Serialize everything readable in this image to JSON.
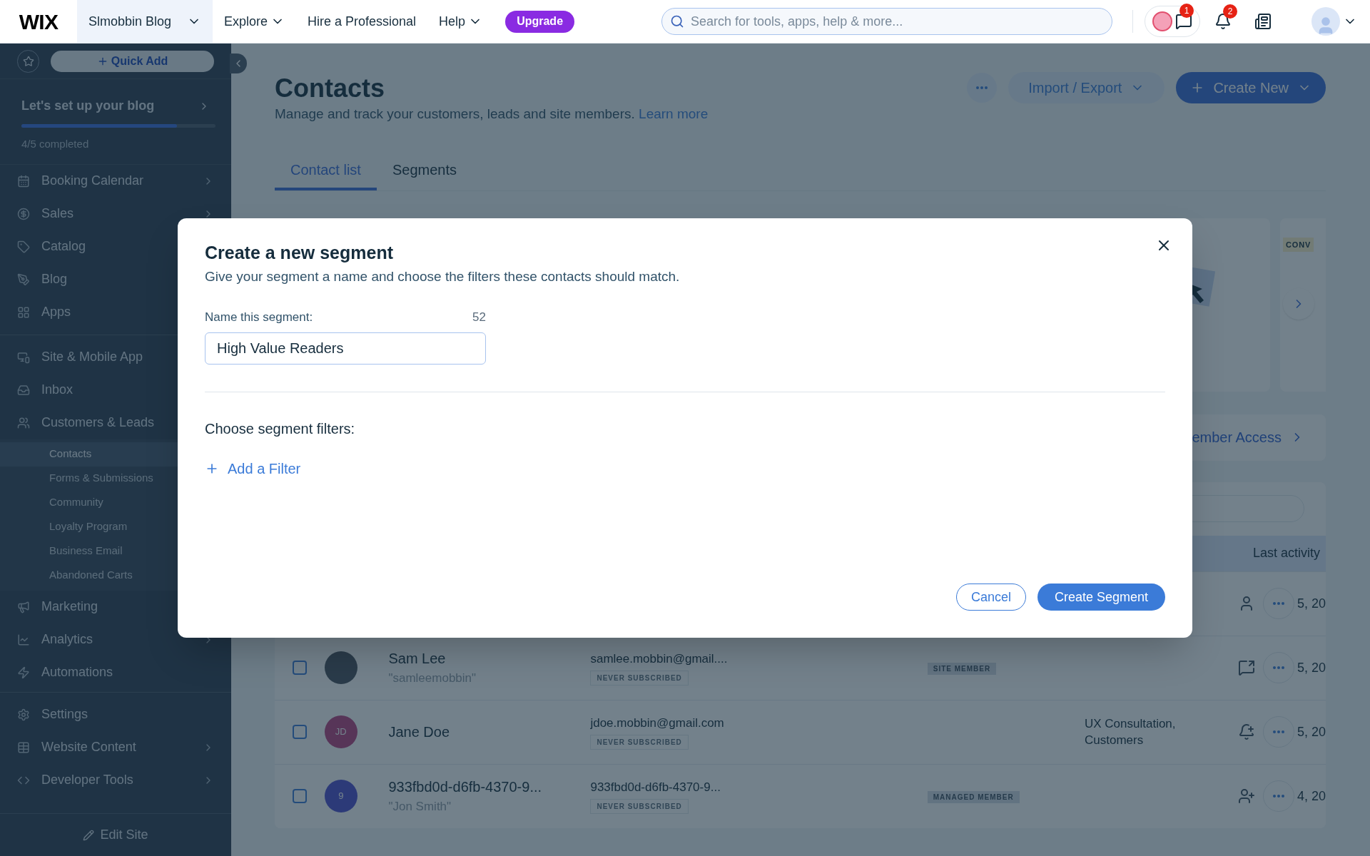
{
  "top_bar": {
    "logo": "WIX",
    "site_selector": "Slmobbin Blog",
    "nav": [
      {
        "label": "Explore",
        "dropdown": true
      },
      {
        "label": "Hire a Professional",
        "dropdown": false
      },
      {
        "label": "Help",
        "dropdown": true
      }
    ],
    "upgrade": "Upgrade",
    "search": {
      "placeholder": "Search for tools, apps, help & more..."
    },
    "chat_badge": "1",
    "notifications_badge": "2"
  },
  "sidebar": {
    "quick_add": "Quick Add",
    "setup": {
      "title": "Let's set up your blog",
      "level": 0.8,
      "progress": "4/5 completed"
    },
    "sections": [
      {
        "items": [
          {
            "label": "Booking Calendar",
            "chevron": true
          },
          {
            "label": "Sales",
            "chevron": true
          },
          {
            "label": "Catalog"
          },
          {
            "label": "Blog"
          },
          {
            "label": "Apps"
          }
        ]
      },
      {
        "items": [
          {
            "label": "Site & Mobile App"
          },
          {
            "label": "Inbox"
          },
          {
            "label": "Customers & Leads",
            "children": [
              {
                "label": "Contacts",
                "selected": true
              },
              {
                "label": "Forms & Submissions",
                "selected": false
              },
              {
                "label": "Community",
                "selected": false
              },
              {
                "label": "Loyalty Program",
                "selected": false
              },
              {
                "label": "Business Email",
                "selected": false
              },
              {
                "label": "Abandoned Carts",
                "selected": false
              }
            ]
          },
          {
            "label": "Marketing"
          },
          {
            "label": "Analytics",
            "chevron": true
          },
          {
            "label": "Automations",
            "chevron": false
          }
        ]
      },
      {
        "items": [
          {
            "label": "Settings",
            "chevron": false
          },
          {
            "label": "Website Content",
            "chevron": true
          },
          {
            "label": "Developer Tools",
            "chevron": true
          }
        ]
      }
    ],
    "edit_site": "Edit Site"
  },
  "page": {
    "title": "Contacts",
    "subtitle": "Manage and track your customers, leads and site members.",
    "learn_more": "Learn more",
    "import_export": "Import / Export",
    "create_new": "Create New",
    "tabs": [
      {
        "label": "Contact list",
        "selected": true
      },
      {
        "label": "Segments",
        "selected": false
      }
    ],
    "promo_tag": "CONV",
    "member_access": "ember Access",
    "table": {
      "last_activity": "Last activity",
      "rows": [
        {
          "date": "5, 20"
        },
        {
          "name": "Sam Lee",
          "nickname": "\"samleemobbin\"",
          "email": "samlee.mobbin@gmail....",
          "subscription": "NEVER SUBSCRIBED",
          "tag": "SITE MEMBER",
          "date": "5, 20",
          "checked": false
        },
        {
          "initials": "JD",
          "name": "Jane Doe",
          "email": "jdoe.mobbin@gmail.com",
          "subscription": "NEVER SUBSCRIBED",
          "labels": "UX Consultation, Customers",
          "date": "5, 20",
          "checked": false
        },
        {
          "initials": "9",
          "name": "933fbd0d-d6fb-4370-9...",
          "nickname": "\"Jon Smith\"",
          "email": "933fbd0d-d6fb-4370-9...",
          "subscription": "NEVER SUBSCRIBED",
          "tag": "MANAGED MEMBER",
          "date": "4, 20",
          "checked": false
        }
      ]
    }
  },
  "modal": {
    "title": "Create a new segment",
    "subtitle": "Give your segment a name and choose the filters these contacts should match.",
    "name_label": "Name this segment:",
    "counter": "52",
    "name_value": "High Value Readers",
    "filters_label": "Choose segment filters:",
    "add_filter": "Add a Filter",
    "cancel": "Cancel",
    "create": "Create Segment"
  }
}
